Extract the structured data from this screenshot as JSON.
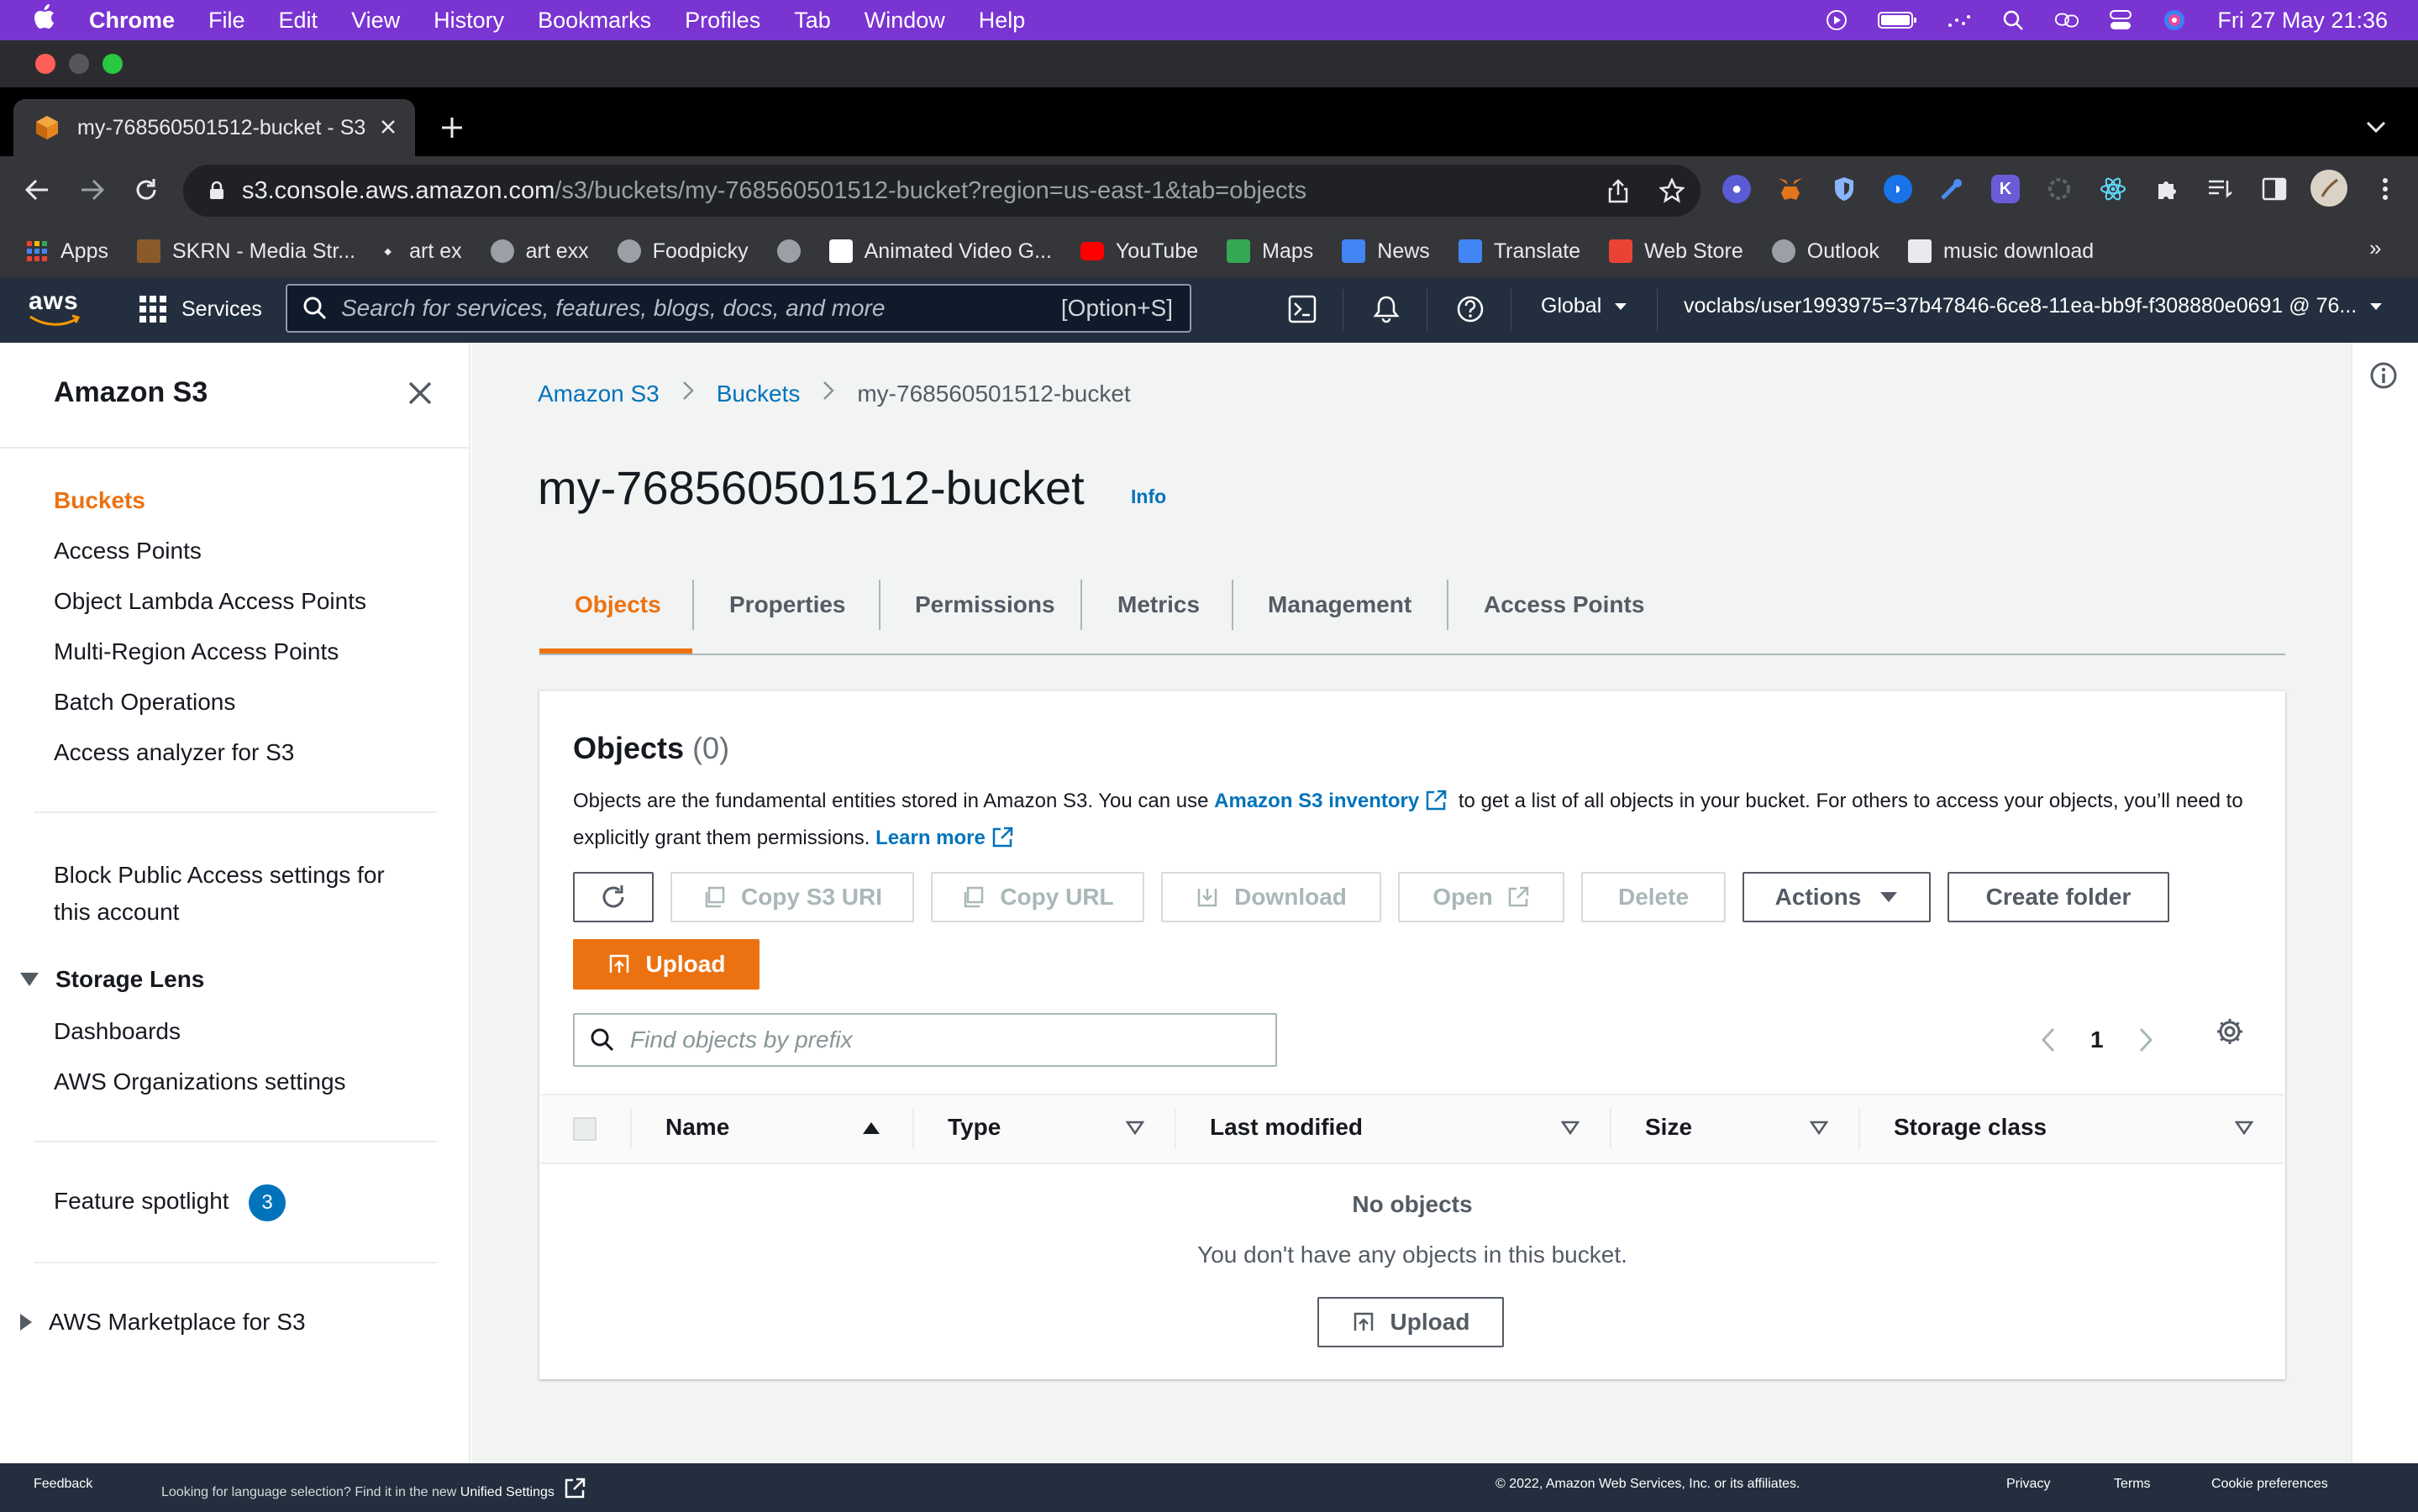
{
  "macos": {
    "app_name": "Chrome",
    "menu": [
      "File",
      "Edit",
      "View",
      "History",
      "Bookmarks",
      "Profiles",
      "Tab",
      "Window",
      "Help"
    ],
    "clock": "Fri 27 May  21:36"
  },
  "browser": {
    "tab_title": "my-768560501512-bucket - S3",
    "url_host": "s3.console.aws.amazon.com",
    "url_path": "/s3/buckets/my-768560501512-bucket?region=us-east-1&tab=objects",
    "bookmarks": [
      "Apps",
      "SKRN - Media Str...",
      "art ex",
      "art exx",
      "Foodpicky",
      "",
      "Animated Video G...",
      "YouTube",
      "Maps",
      "News",
      "Translate",
      "Web Store",
      "Outlook",
      "music download"
    ],
    "bookmark_more": "»"
  },
  "aws_nav": {
    "logo": "aws",
    "services_label": "Services",
    "search_placeholder": "Search for services, features, blogs, docs, and more",
    "search_shortcut": "[Option+S]",
    "region": "Global",
    "account": "voclabs/user1993975=37b47846-6ce8-11ea-bb9f-f308880e0691 @ 76..."
  },
  "sidebar": {
    "title": "Amazon S3",
    "items": [
      "Buckets",
      "Access Points",
      "Object Lambda Access Points",
      "Multi-Region Access Points",
      "Batch Operations",
      "Access analyzer for S3"
    ],
    "block_public_line1": "Block Public Access settings for",
    "block_public_line2": "this account",
    "storage_lens": "Storage Lens",
    "storage_lens_items": [
      "Dashboards",
      "AWS Organizations settings"
    ],
    "feature_spotlight": "Feature spotlight",
    "feature_spotlight_count": "3",
    "marketplace": "AWS Marketplace for S3"
  },
  "breadcrumb": [
    "Amazon S3",
    "Buckets",
    "my-768560501512-bucket"
  ],
  "page": {
    "title": "my-768560501512-bucket",
    "info": "Info",
    "tabs": [
      "Objects",
      "Properties",
      "Permissions",
      "Metrics",
      "Management",
      "Access Points"
    ]
  },
  "objects_panel": {
    "heading": "Objects",
    "count": "(0)",
    "desc_1": "Objects are the fundamental entities stored in Amazon S3. You can use ",
    "desc_link_1": "Amazon S3 inventory",
    "desc_2": " to get a list of all objects in your bucket. For others to access your objects, you’ll need to explicitly grant them permissions. ",
    "desc_link_2": "Learn more",
    "buttons": {
      "copy_uri": "Copy S3 URI",
      "copy_url": "Copy URL",
      "download": "Download",
      "open": "Open",
      "delete": "Delete",
      "actions": "Actions",
      "create_folder": "Create folder",
      "upload": "Upload"
    },
    "find_placeholder": "Find objects by prefix",
    "page_number": "1",
    "columns": [
      "Name",
      "Type",
      "Last modified",
      "Size",
      "Storage class"
    ],
    "empty_title": "No objects",
    "empty_text": "You don't have any objects in this bucket.",
    "empty_upload": "Upload"
  },
  "footer": {
    "feedback": "Feedback",
    "lang_text": "Looking for language selection? Find it in the new ",
    "lang_link": "Unified Settings",
    "copyright": "© 2022, Amazon Web Services, Inc. or its affiliates.",
    "privacy": "Privacy",
    "terms": "Terms",
    "cookies": "Cookie preferences"
  },
  "colors": {
    "mac_menubar": "#7a34d2",
    "aws_squid": "#232f3e",
    "aws_orange": "#ec7211",
    "aws_link": "#0073bb"
  }
}
